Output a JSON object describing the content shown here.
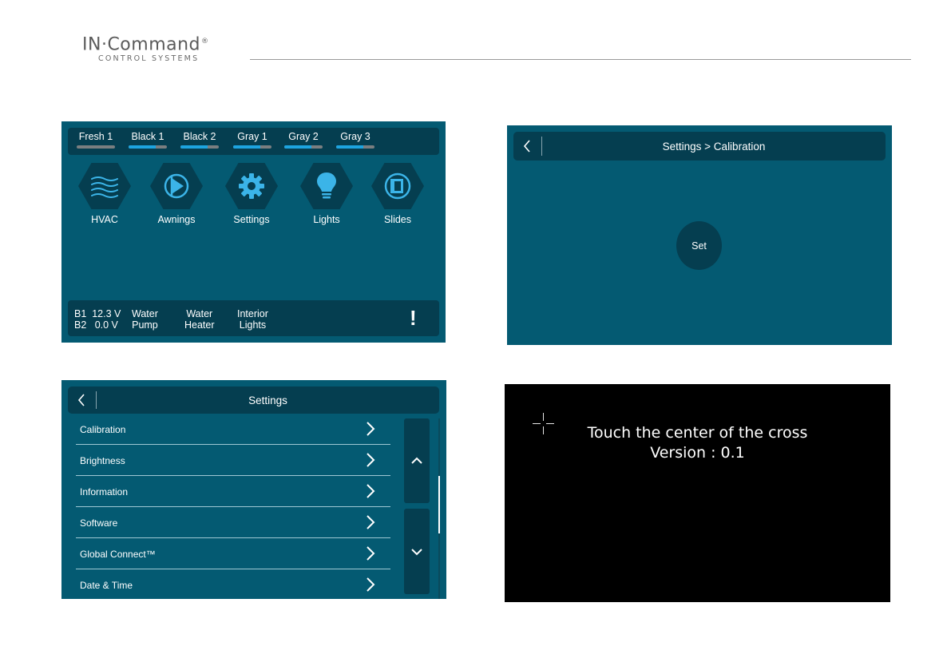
{
  "header": {
    "brand": "IN·Command",
    "brand_mark": "®",
    "subtitle": "CONTROL SYSTEMS"
  },
  "home": {
    "tanks": [
      {
        "label": "Fresh 1",
        "level": 0
      },
      {
        "label": "Black 1",
        "level": 0.7
      },
      {
        "label": "Black 2",
        "level": 0.7
      },
      {
        "label": "Gray 1",
        "level": 0.7
      },
      {
        "label": "Gray 2",
        "level": 0.7
      },
      {
        "label": "Gray 3",
        "level": 0.7
      }
    ],
    "buttons": [
      {
        "label": "HVAC",
        "icon": "hvac-waves-icon"
      },
      {
        "label": "Awnings",
        "icon": "awning-icon"
      },
      {
        "label": "Settings",
        "icon": "gear-icon"
      },
      {
        "label": "Lights",
        "icon": "lightbulb-icon"
      },
      {
        "label": "Slides",
        "icon": "slide-icon"
      }
    ],
    "status": {
      "b1": "B1  12.3 V",
      "b2": "B2   0.0 V",
      "water_pump": [
        "Water",
        "Pump"
      ],
      "water_heater": [
        "Water",
        "Heater"
      ],
      "interior_lights": [
        "Interior",
        "Lights"
      ],
      "alert": "!"
    }
  },
  "calibration": {
    "title": "Settings > Calibration",
    "set_label": "Set"
  },
  "settings": {
    "title": "Settings",
    "items": [
      "Calibration",
      "Brightness",
      "Information",
      "Software",
      "Global Connect™",
      "Date & Time"
    ]
  },
  "touch": {
    "instruction": "Touch the center of the cross",
    "version": "Version : 0.1"
  },
  "colors": {
    "screen_bg": "#045a72",
    "panel_bg": "#053e50",
    "tank_fill": "#1da4e0"
  }
}
